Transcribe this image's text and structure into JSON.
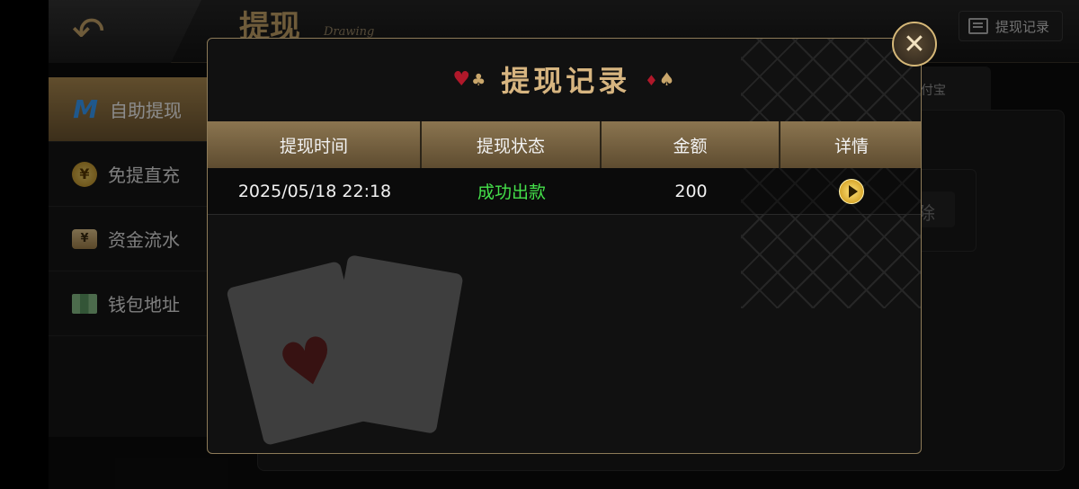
{
  "header": {
    "back_label": "↶",
    "title": "提现",
    "subtitle": "Drawing",
    "record_button": "提现记录"
  },
  "sidebar": {
    "items": [
      {
        "label": "自助提现",
        "icon": "m-logo-icon"
      },
      {
        "label": "免提直充",
        "icon": "coin-icon"
      },
      {
        "label": "资金流水",
        "icon": "wallet-icon"
      },
      {
        "label": "钱包地址",
        "icon": "map-icon"
      }
    ]
  },
  "background": {
    "tab_fragment": "付宝",
    "field_fragment": "除"
  },
  "modal": {
    "title": "提现记录",
    "suits_left": [
      "♥",
      "♣"
    ],
    "suits_right": [
      "♦",
      "♠"
    ],
    "columns": [
      "提现时间",
      "提现状态",
      "金额",
      "详情"
    ],
    "rows": [
      {
        "time": "2025/05/18 22:18",
        "status": "成功出款",
        "amount": "200"
      }
    ],
    "close_label": "✕"
  },
  "colors": {
    "accent_gold": "#c9a66b",
    "status_success": "#44e04a",
    "header_row": "#8b7550"
  }
}
